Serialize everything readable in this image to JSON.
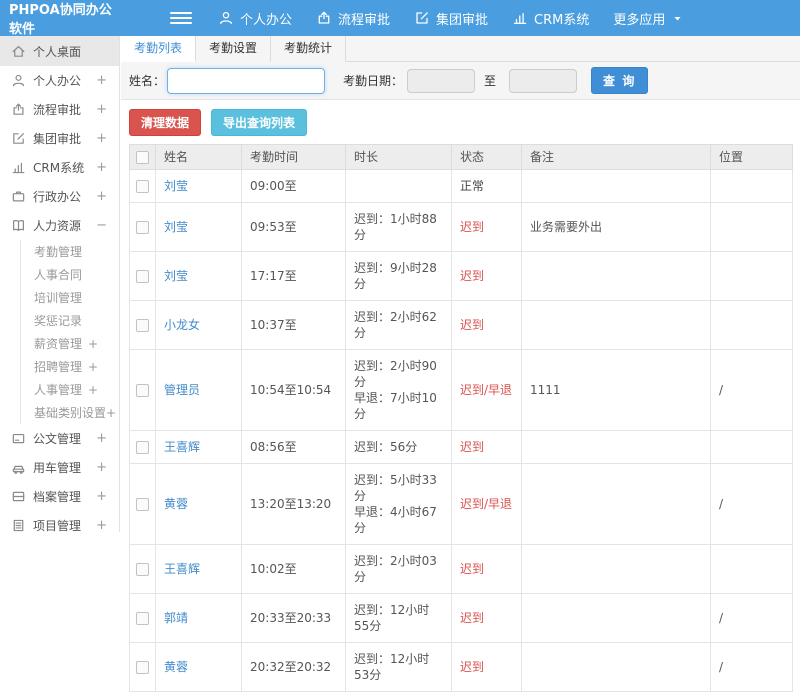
{
  "navbar": {
    "brand": "PHPOA协同办公软件",
    "menu": [
      {
        "label": "个人办公",
        "icon": "user-icon"
      },
      {
        "label": "流程审批",
        "icon": "share-icon"
      },
      {
        "label": "集团审批",
        "icon": "edit-icon"
      },
      {
        "label": "CRM系统",
        "icon": "chart-icon"
      },
      {
        "label": "更多应用",
        "icon": "caret-down-icon"
      }
    ]
  },
  "sidebar": {
    "items": [
      {
        "label": "个人桌面",
        "icon": "home-icon",
        "suffix": "",
        "active": true
      },
      {
        "label": "个人办公",
        "icon": "user-icon",
        "suffix": "+"
      },
      {
        "label": "流程审批",
        "icon": "share-icon",
        "suffix": "+"
      },
      {
        "label": "集团审批",
        "icon": "edit-icon",
        "suffix": "+"
      },
      {
        "label": "CRM系统",
        "icon": "chart-icon",
        "suffix": "+"
      },
      {
        "label": "行政办公",
        "icon": "briefcase-icon",
        "suffix": "+"
      },
      {
        "label": "人力资源",
        "icon": "book-icon",
        "suffix": "−",
        "children": [
          {
            "label": "考勤管理",
            "suffix": ""
          },
          {
            "label": "人事合同",
            "suffix": ""
          },
          {
            "label": "培训管理",
            "suffix": ""
          },
          {
            "label": "奖惩记录",
            "suffix": ""
          },
          {
            "label": "薪资管理",
            "suffix": "+"
          },
          {
            "label": "招聘管理",
            "suffix": "+"
          },
          {
            "label": "人事管理",
            "suffix": "+"
          },
          {
            "label": "基础类别设置",
            "suffix": "+"
          }
        ]
      },
      {
        "label": "公文管理",
        "icon": "doc-icon",
        "suffix": "+"
      },
      {
        "label": "用车管理",
        "icon": "car-icon",
        "suffix": "+"
      },
      {
        "label": "档案管理",
        "icon": "archive-icon",
        "suffix": "+"
      },
      {
        "label": "项目管理",
        "icon": "project-icon",
        "suffix": "+"
      }
    ]
  },
  "tabs": [
    {
      "label": "考勤列表",
      "active": true
    },
    {
      "label": "考勤设置",
      "active": false
    },
    {
      "label": "考勤统计",
      "active": false
    }
  ],
  "filter": {
    "name_label": "姓名：",
    "name_value": "",
    "date_label": "考勤日期：",
    "date_from": "",
    "to_label": "至",
    "date_to": "",
    "search_button": "查 询"
  },
  "actions": {
    "clean_button": "清理数据",
    "export_button": "导出查询列表"
  },
  "table": {
    "columns": [
      "姓名",
      "考勤时间",
      "时长",
      "状态",
      "备注",
      "位置"
    ],
    "rows": [
      {
        "name": "刘莹",
        "time": "09:00至",
        "duration": "",
        "status": "正常",
        "status_type": "normal",
        "remark": "",
        "location": ""
      },
      {
        "name": "刘莹",
        "time": "09:53至",
        "duration": "迟到：1小时88分",
        "status": "迟到",
        "status_type": "late",
        "remark": "业务需要外出",
        "location": ""
      },
      {
        "name": "刘莹",
        "time": "17:17至",
        "duration": "迟到：9小时28分",
        "status": "迟到",
        "status_type": "late",
        "remark": "",
        "location": ""
      },
      {
        "name": "小龙女",
        "time": "10:37至",
        "duration": "迟到：2小时62分",
        "status": "迟到",
        "status_type": "late",
        "remark": "",
        "location": ""
      },
      {
        "name": "管理员",
        "time": "10:54至10:54",
        "duration": "迟到：2小时90分\n早退：7小时10分",
        "status": "迟到/早退",
        "status_type": "late",
        "remark": "1111",
        "location": "/"
      },
      {
        "name": "王喜辉",
        "time": "08:56至",
        "duration": "迟到：56分",
        "status": "迟到",
        "status_type": "late",
        "remark": "",
        "location": ""
      },
      {
        "name": "黄蓉",
        "time": "13:20至13:20",
        "duration": "迟到：5小时33分\n早退：4小时67分",
        "status": "迟到/早退",
        "status_type": "late",
        "remark": "",
        "location": "/"
      },
      {
        "name": "王喜辉",
        "time": "10:02至",
        "duration": "迟到：2小时03分",
        "status": "迟到",
        "status_type": "late",
        "remark": "",
        "location": ""
      },
      {
        "name": "郭靖",
        "time": "20:33至20:33",
        "duration": "迟到：12小时55分",
        "status": "迟到",
        "status_type": "late",
        "remark": "",
        "location": "/"
      },
      {
        "name": "黄蓉",
        "time": "20:32至20:32",
        "duration": "迟到：12小时53分",
        "status": "迟到",
        "status_type": "late",
        "remark": "",
        "location": "/"
      }
    ]
  },
  "colors": {
    "navbar": "#4a9dde",
    "primary": "#3f8ed6",
    "danger": "#d9534f",
    "info": "#5bc0de",
    "link": "#428bca",
    "late_text": "#d9534f"
  }
}
